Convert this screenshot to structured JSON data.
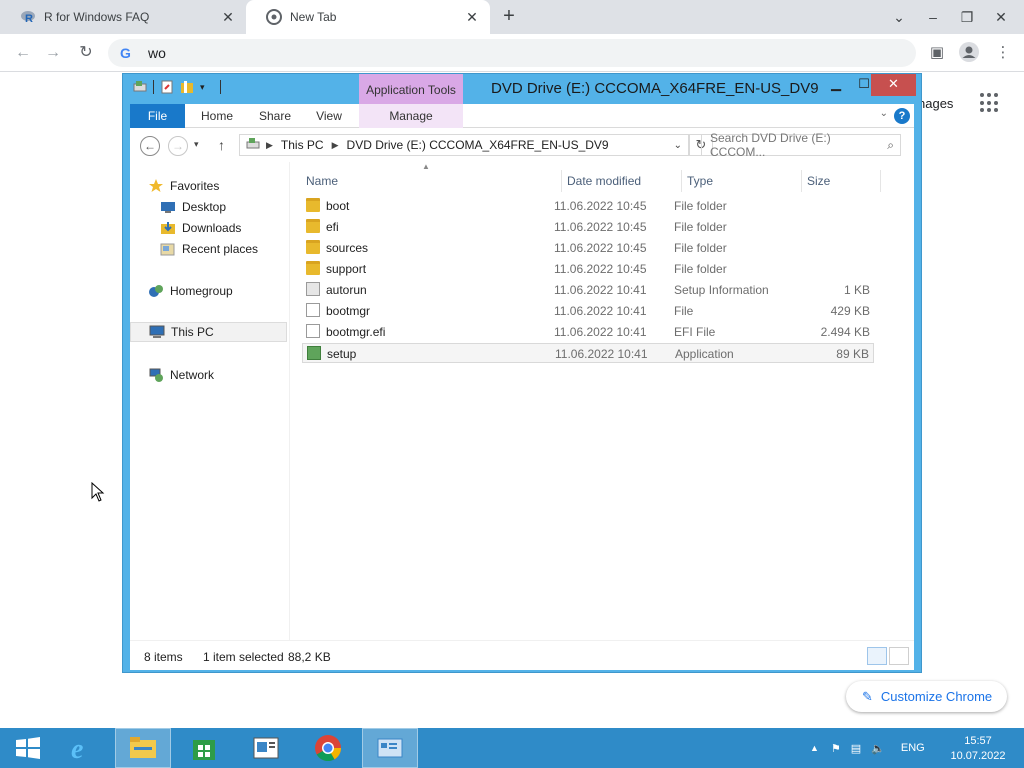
{
  "chrome": {
    "tabs": [
      {
        "title": "R for Windows FAQ"
      },
      {
        "title": "New Tab"
      }
    ],
    "omnibox_value": "wo",
    "ntp_images_link": "nages",
    "customize_label": "Customize Chrome"
  },
  "explorer": {
    "title": "DVD Drive (E:) CCCOMA_X64FRE_EN-US_DV9",
    "context_tab": "Application Tools",
    "ribbon_tabs": [
      "File",
      "Home",
      "Share",
      "View",
      "Manage"
    ],
    "address": {
      "segments": [
        "This PC",
        "DVD Drive (E:) CCCOMA_X64FRE_EN-US_DV9"
      ]
    },
    "search_placeholder": "Search DVD Drive (E:) CCCOM...",
    "nav": {
      "favorites": "Favorites",
      "desktop": "Desktop",
      "downloads": "Downloads",
      "recent": "Recent places",
      "homegroup": "Homegroup",
      "thispc": "This PC",
      "network": "Network"
    },
    "columns": {
      "name": "Name",
      "date": "Date modified",
      "type": "Type",
      "size": "Size"
    },
    "rows": [
      {
        "name": "boot",
        "date": "11.06.2022 10:45",
        "type": "File folder",
        "size": "",
        "icon": "folder-icon"
      },
      {
        "name": "efi",
        "date": "11.06.2022 10:45",
        "type": "File folder",
        "size": "",
        "icon": "folder-icon"
      },
      {
        "name": "sources",
        "date": "11.06.2022 10:45",
        "type": "File folder",
        "size": "",
        "icon": "folder-icon"
      },
      {
        "name": "support",
        "date": "11.06.2022 10:45",
        "type": "File folder",
        "size": "",
        "icon": "folder-icon"
      },
      {
        "name": "autorun",
        "date": "11.06.2022 10:41",
        "type": "Setup Information",
        "size": "1 KB",
        "icon": "setup-info-icon"
      },
      {
        "name": "bootmgr",
        "date": "11.06.2022 10:41",
        "type": "File",
        "size": "429 KB",
        "icon": "file-icon"
      },
      {
        "name": "bootmgr.efi",
        "date": "11.06.2022 10:41",
        "type": "EFI File",
        "size": "2.494 KB",
        "icon": "file-icon"
      },
      {
        "name": "setup",
        "date": "11.06.2022 10:41",
        "type": "Application",
        "size": "89 KB",
        "icon": "application-icon",
        "selected": true
      }
    ],
    "status": {
      "items": "8 items",
      "selected": "1 item selected",
      "size": "88,2 KB"
    }
  },
  "taskbar": {
    "language": "ENG",
    "time": "15:57",
    "date": "10.07.2022"
  },
  "colors": {
    "explorer_frame": "#53b2e8",
    "file_tab": "#1979ca",
    "app_tools": "#d9a8e6",
    "taskbar": "#2f8bc8",
    "close_button": "#c7504f"
  }
}
